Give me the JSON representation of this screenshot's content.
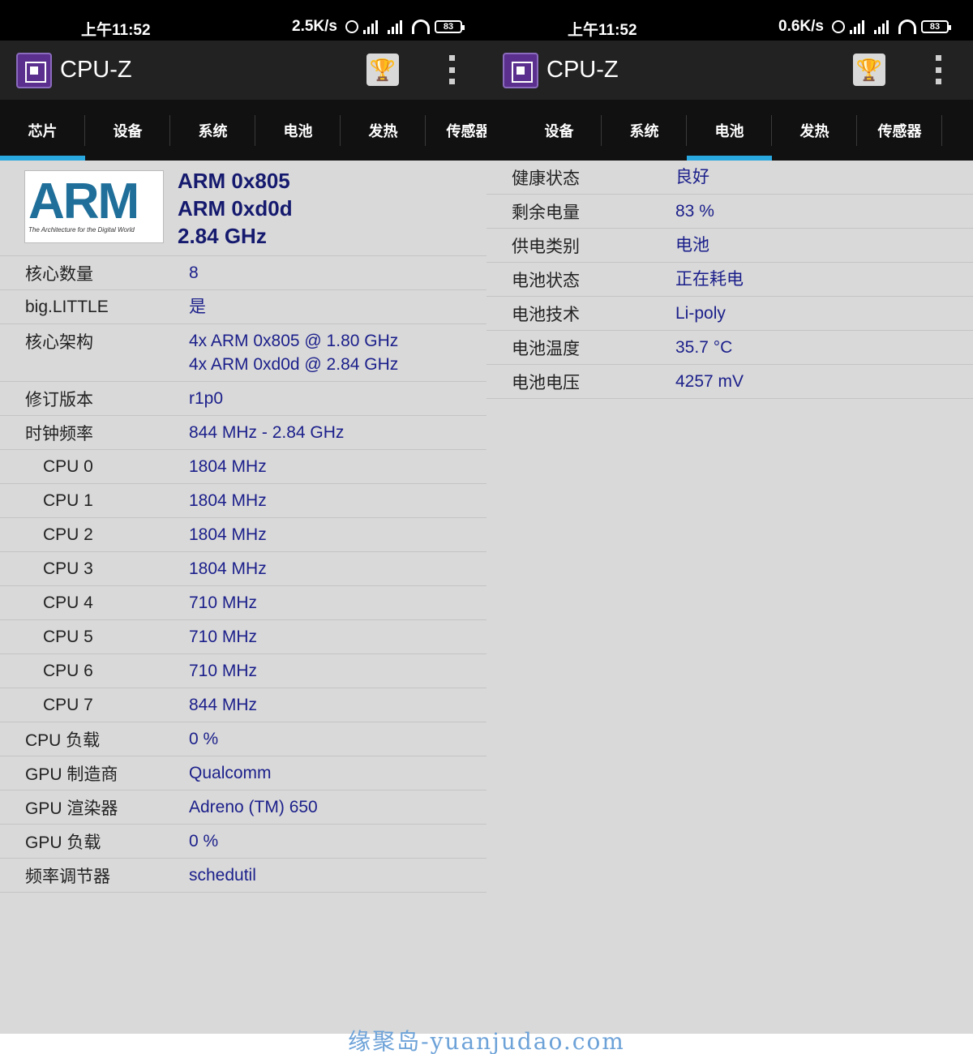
{
  "left": {
    "status": {
      "time": "上午11:52",
      "speed": "2.5K/s",
      "battery": "83"
    },
    "app": {
      "title": "CPU-Z"
    },
    "tabs": [
      "芯片",
      "设备",
      "系统",
      "电池",
      "发热",
      "传感器"
    ],
    "active_tab": "芯片",
    "logo": {
      "brand": "ARM",
      "tagline": "The Architecture for the Digital World"
    },
    "header": {
      "line1": "ARM 0x805",
      "line2": "ARM 0xd0d",
      "line3": "2.84 GHz"
    },
    "rows": [
      {
        "label": "核心数量",
        "value": "8"
      },
      {
        "label": "big.LITTLE",
        "value": "是"
      },
      {
        "label": "核心架构",
        "value": "4x ARM 0x805 @ 1.80 GHz",
        "value2": "4x ARM 0xd0d @ 2.84 GHz"
      },
      {
        "label": "修订版本",
        "value": "r1p0"
      },
      {
        "label": "时钟频率",
        "value": "844 MHz - 2.84 GHz"
      },
      {
        "label": "CPU 0",
        "value": "1804 MHz"
      },
      {
        "label": "CPU 1",
        "value": "1804 MHz"
      },
      {
        "label": "CPU 2",
        "value": "1804 MHz"
      },
      {
        "label": "CPU 3",
        "value": "1804 MHz"
      },
      {
        "label": "CPU 4",
        "value": "710 MHz"
      },
      {
        "label": "CPU 5",
        "value": "710 MHz"
      },
      {
        "label": "CPU 6",
        "value": "710 MHz"
      },
      {
        "label": "CPU 7",
        "value": "844 MHz"
      },
      {
        "label": "CPU 负载",
        "value": "0 %"
      },
      {
        "label": "GPU 制造商",
        "value": "Qualcomm"
      },
      {
        "label": "GPU 渲染器",
        "value": "Adreno (TM) 650"
      },
      {
        "label": "GPU 负载",
        "value": "0 %"
      },
      {
        "label": "频率调节器",
        "value": "schedutil"
      }
    ]
  },
  "right": {
    "status": {
      "time": "上午11:52",
      "speed": "0.6K/s",
      "battery": "83"
    },
    "app": {
      "title": "CPU-Z"
    },
    "tabs": [
      "设备",
      "系统",
      "电池",
      "发热",
      "传感器"
    ],
    "active_tab": "电池",
    "rows": [
      {
        "label": "健康状态",
        "value": "良好"
      },
      {
        "label": "剩余电量",
        "value": "83 %"
      },
      {
        "label": "供电类别",
        "value": "电池"
      },
      {
        "label": "电池状态",
        "value": "正在耗电"
      },
      {
        "label": "电池技术",
        "value": "Li-poly"
      },
      {
        "label": "电池温度",
        "value": "35.7 °C"
      },
      {
        "label": "电池电压",
        "value": "4257 mV"
      }
    ]
  },
  "watermark": "缘聚岛-yuanjudao.com",
  "colors": {
    "accent": "#29a8e0",
    "value_text": "#1b1f8a",
    "background": "#d9d9d9",
    "tabbar": "#111111",
    "appbar": "#222222"
  }
}
